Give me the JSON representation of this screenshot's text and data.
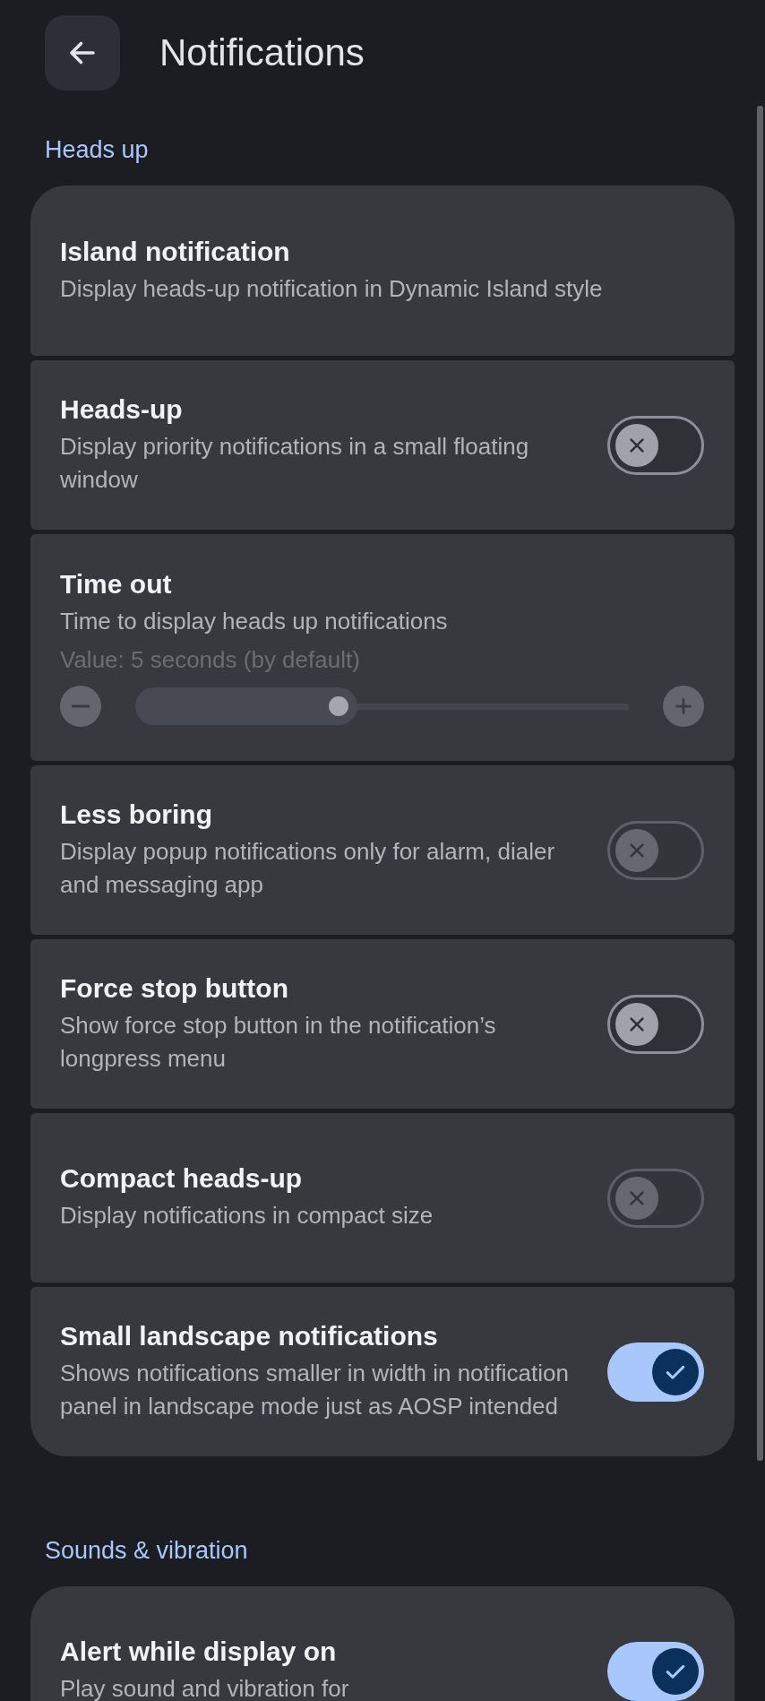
{
  "header": {
    "title": "Notifications"
  },
  "sections": [
    {
      "title": "Heads up",
      "items": [
        {
          "kind": "text",
          "title": "Island notification",
          "subtitle": "Display heads-up notification in Dynamic Island style"
        },
        {
          "kind": "switch",
          "title": "Heads-up",
          "subtitle": "Display priority notifications in a small floating window",
          "on": false,
          "disabled": false
        },
        {
          "kind": "slider",
          "title": "Time out",
          "subtitle": "Time to display heads up notifications",
          "value_text": "Value: 5 seconds (by default)",
          "level": 0.45
        },
        {
          "kind": "switch",
          "title": "Less boring",
          "subtitle": "Display popup notifications only for alarm, dialer and messaging app",
          "on": false,
          "disabled": true
        },
        {
          "kind": "switch",
          "title": "Force stop button",
          "subtitle": "Show force stop button in the notification’s longpress menu",
          "on": false,
          "disabled": false
        },
        {
          "kind": "switch",
          "title": "Compact heads-up",
          "subtitle": "Display notifications in compact size",
          "on": false,
          "disabled": true
        },
        {
          "kind": "switch",
          "title": "Small landscape notifications",
          "subtitle": "Shows notifications smaller in width in notification panel in landscape mode just as AOSP intended",
          "on": true,
          "disabled": false
        }
      ]
    },
    {
      "title": "Sounds & vibration",
      "items": [
        {
          "kind": "switch",
          "title": "Alert while display on",
          "subtitle": "Play sound and vibration for",
          "on": true,
          "disabled": false
        }
      ]
    }
  ]
}
